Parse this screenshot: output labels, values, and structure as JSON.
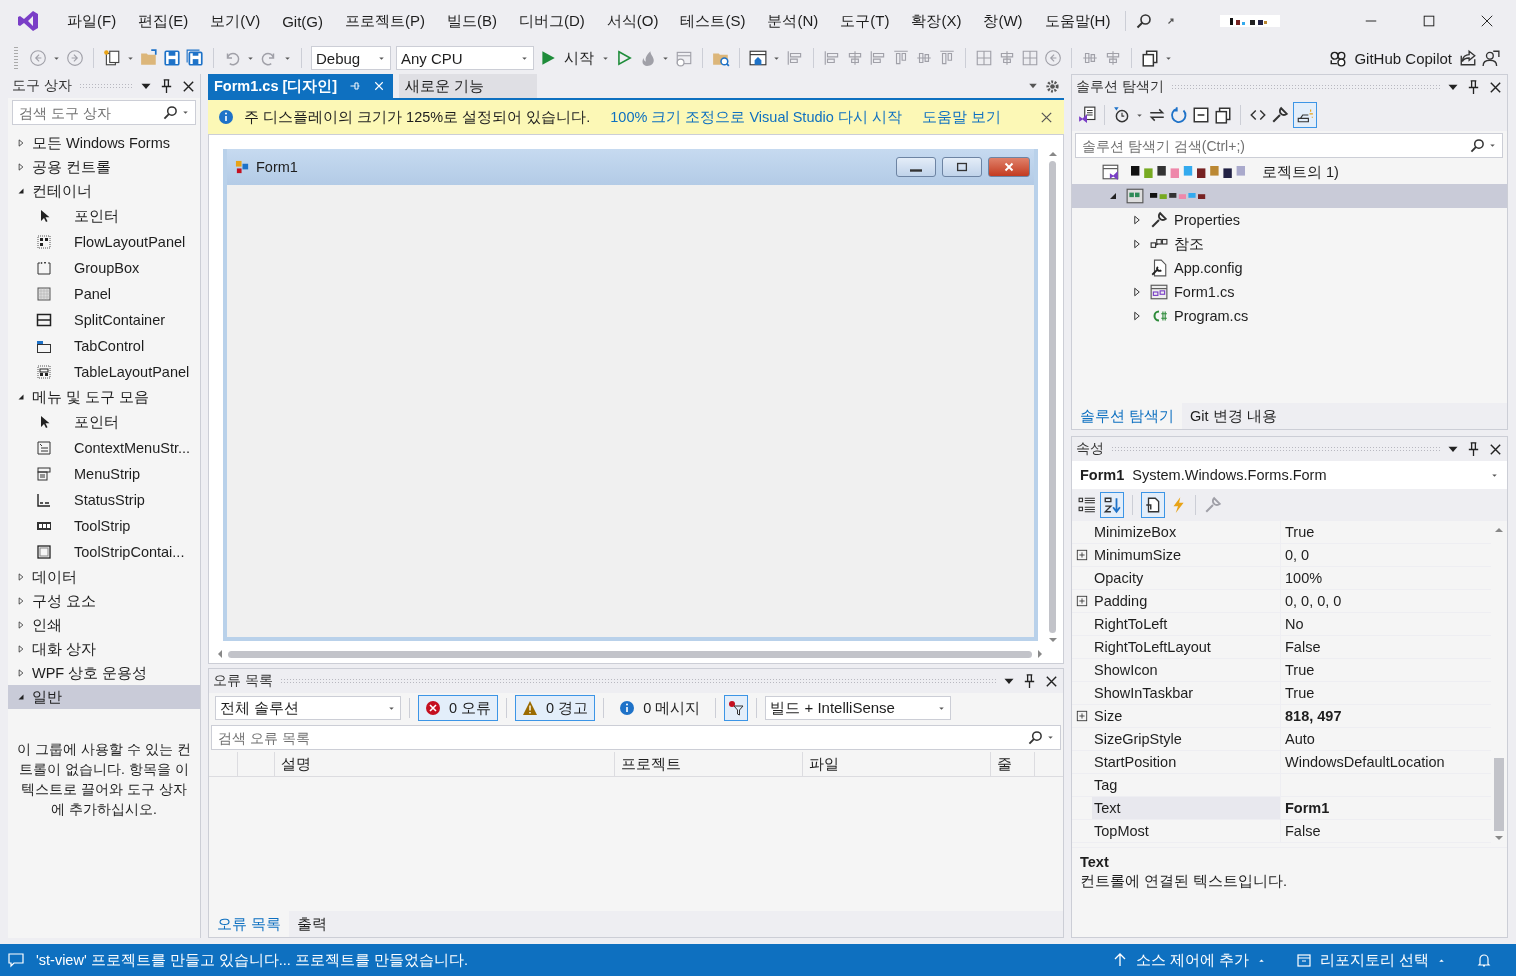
{
  "menu": [
    "파일(F)",
    "편집(E)",
    "보기(V)",
    "Git(G)",
    "프로젝트(P)",
    "빌드(B)",
    "디버그(D)",
    "서식(O)",
    "테스트(S)",
    "분석(N)",
    "도구(T)",
    "확장(X)",
    "창(W)",
    "도움말(H)"
  ],
  "toolbar": {
    "configuration": "Debug",
    "platform": "Any CPU",
    "start": "시작",
    "copilot": "GitHub Copilot"
  },
  "toolbox": {
    "title": "도구 상자",
    "search_placeholder": "검색 도구 상자",
    "groups": [
      {
        "label": "모든 Windows Forms",
        "expanded": false,
        "selected": false
      },
      {
        "label": "공용 컨트롤",
        "expanded": false,
        "selected": false
      },
      {
        "label": "컨테이너",
        "expanded": true,
        "selected": false,
        "children": [
          {
            "label": "포인터",
            "kind": "pointer"
          },
          {
            "label": "FlowLayoutPanel",
            "kind": "flow"
          },
          {
            "label": "GroupBox",
            "kind": "groupbox"
          },
          {
            "label": "Panel",
            "kind": "panel"
          },
          {
            "label": "SplitContainer",
            "kind": "split"
          },
          {
            "label": "TabControl",
            "kind": "tab"
          },
          {
            "label": "TableLayoutPanel",
            "kind": "table"
          }
        ]
      },
      {
        "label": "메뉴 및 도구 모음",
        "expanded": true,
        "selected": false,
        "children": [
          {
            "label": "포인터",
            "kind": "pointer"
          },
          {
            "label": "ContextMenuStr...",
            "kind": "contextmenu"
          },
          {
            "label": "MenuStrip",
            "kind": "menustrip"
          },
          {
            "label": "StatusStrip",
            "kind": "statusstrip"
          },
          {
            "label": "ToolStrip",
            "kind": "toolstrip"
          },
          {
            "label": "ToolStripContai...",
            "kind": "container"
          }
        ]
      },
      {
        "label": "데이터",
        "expanded": false,
        "selected": false
      },
      {
        "label": "구성 요소",
        "expanded": false,
        "selected": false
      },
      {
        "label": "인쇄",
        "expanded": false,
        "selected": false
      },
      {
        "label": "대화 상자",
        "expanded": false,
        "selected": false
      },
      {
        "label": "WPF 상호 운용성",
        "expanded": false,
        "selected": false
      },
      {
        "label": "일반",
        "expanded": true,
        "selected": true
      }
    ],
    "empty_message": "이 그룹에 사용할 수 있는 컨트롤이 없습니다. 항목을 이 텍스트로 끌어와 도구 상자에 추가하십시오."
  },
  "document_tabs": [
    {
      "label": "Form1.cs [디자인]",
      "selected": true
    },
    {
      "label": "새로운 기능",
      "selected": false
    }
  ],
  "info_bar": {
    "message": "주 디스플레이의 크기가 125%로 설정되어 있습니다.",
    "links": [
      "100% 크기 조정으로 Visual Studio 다시 시작",
      "도움말 보기"
    ]
  },
  "designer": {
    "form_title": "Form1"
  },
  "error_list": {
    "title": "오류 목록",
    "scope": "전체 솔루션",
    "errors": "0 오류",
    "warnings": "0 경고",
    "messages": "0 메시지",
    "filter": "빌드 + IntelliSense",
    "search_placeholder": "검색 오류 목록",
    "columns": [
      "설명",
      "프로젝트",
      "파일",
      "줄"
    ],
    "tabs": [
      {
        "label": "오류 목록",
        "selected": true
      },
      {
        "label": "출력",
        "selected": false
      }
    ]
  },
  "solution_explorer": {
    "title": "솔루션 탐색기",
    "search_placeholder": "솔루션 탐색기 검색(Ctrl+;)",
    "tree": [
      {
        "kind": "solution",
        "label": "로젝트의 1)",
        "selected": false,
        "children": [
          {
            "kind": "project",
            "expanded": true,
            "selected": true,
            "children": [
              {
                "kind": "properties",
                "label": "Properties",
                "expanded": false,
                "selected": false
              },
              {
                "kind": "references",
                "label": "참조",
                "expanded": false,
                "selected": false
              },
              {
                "kind": "config",
                "label": "App.config",
                "selected": false
              },
              {
                "kind": "form",
                "label": "Form1.cs",
                "expanded": false,
                "selected": false
              },
              {
                "kind": "csharp",
                "label": "Program.cs",
                "expanded": false,
                "selected": false
              }
            ]
          }
        ]
      }
    ],
    "tabs": [
      {
        "label": "솔루션 탐색기",
        "selected": true
      },
      {
        "label": "Git 변경 내용",
        "selected": false
      }
    ]
  },
  "properties": {
    "title": "속성",
    "object_name": "Form1",
    "object_type": "System.Windows.Forms.Form",
    "rows": [
      {
        "name": "MinimizeBox",
        "value": "True",
        "expandable": false,
        "bold": false,
        "selected": false
      },
      {
        "name": "MinimumSize",
        "value": "0, 0",
        "expandable": true,
        "bold": false,
        "selected": false
      },
      {
        "name": "Opacity",
        "value": "100%",
        "expandable": false,
        "bold": false,
        "selected": false
      },
      {
        "name": "Padding",
        "value": "0, 0, 0, 0",
        "expandable": true,
        "bold": false,
        "selected": false
      },
      {
        "name": "RightToLeft",
        "value": "No",
        "expandable": false,
        "bold": false,
        "selected": false
      },
      {
        "name": "RightToLeftLayout",
        "value": "False",
        "expandable": false,
        "bold": false,
        "selected": false
      },
      {
        "name": "ShowIcon",
        "value": "True",
        "expandable": false,
        "bold": false,
        "selected": false
      },
      {
        "name": "ShowInTaskbar",
        "value": "True",
        "expandable": false,
        "bold": false,
        "selected": false
      },
      {
        "name": "Size",
        "value": "818, 497",
        "expandable": true,
        "bold": true,
        "selected": false
      },
      {
        "name": "SizeGripStyle",
        "value": "Auto",
        "expandable": false,
        "bold": false,
        "selected": false
      },
      {
        "name": "StartPosition",
        "value": "WindowsDefaultLocation",
        "expandable": false,
        "bold": false,
        "selected": false
      },
      {
        "name": "Tag",
        "expandable": false,
        "selected": false
      },
      {
        "name": "Text",
        "value": "Form1",
        "expandable": false,
        "bold": true,
        "selected": true
      },
      {
        "name": "TopMost",
        "value": "False",
        "expandable": false,
        "bold": false,
        "selected": false
      }
    ],
    "description_title": "Text",
    "description": "컨트롤에 연결된 텍스트입니다."
  },
  "status_bar": {
    "message": "'st-view' 프로젝트를 만들고 있습니다... 프로젝트를 만들었습니다.",
    "source_control": "소스 제어에 추가",
    "repository": "리포지토리 선택"
  }
}
